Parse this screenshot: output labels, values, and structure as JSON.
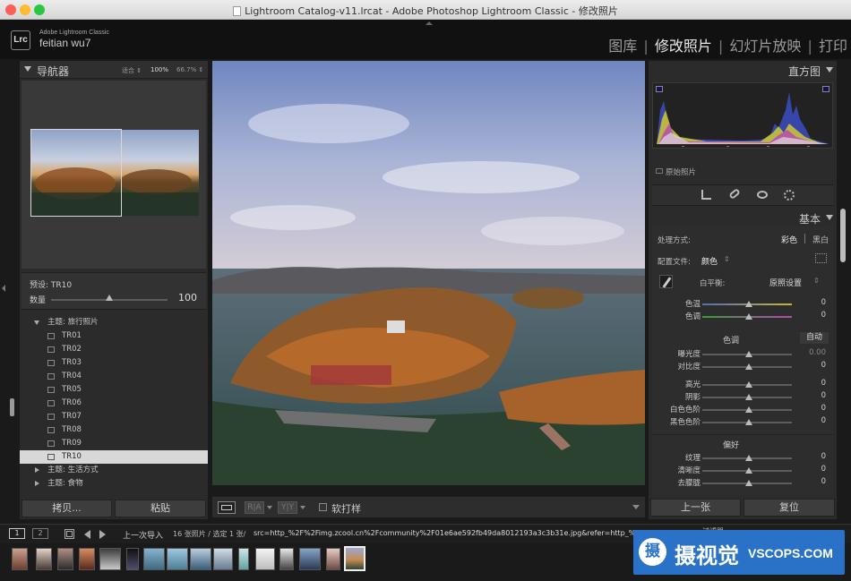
{
  "window": {
    "title": "Lightroom Catalog-v11.lrcat - Adobe Photoshop Lightroom Classic - 修改照片"
  },
  "identity": {
    "logo": "Lrc",
    "app_name": "Adobe Lightroom Classic",
    "user": "feitian wu7"
  },
  "modules": [
    {
      "label": "图库",
      "active": false
    },
    {
      "label": "修改照片",
      "active": true
    },
    {
      "label": "幻灯片放映",
      "active": false
    },
    {
      "label": "打印",
      "active": false
    }
  ],
  "navigator": {
    "title": "导航器",
    "zoom_fit": "适合 ⇕",
    "zoom_100": "100%",
    "zoom_other": "66.7% ⇕"
  },
  "preset_amount": {
    "preset_label": "预设: TR10",
    "amount_label": "数量",
    "amount_value": "100",
    "amount_fraction": 0.55
  },
  "presets": {
    "group_travel": "主题: 旅行照片",
    "items": [
      "TR01",
      "TR02",
      "TR03",
      "TR04",
      "TR05",
      "TR06",
      "TR07",
      "TR08",
      "TR09",
      "TR10"
    ],
    "selected": "TR10",
    "group_life": "主题: 生活方式",
    "group_food": "主题: 食物"
  },
  "left_buttons": {
    "copy": "拷贝...",
    "paste": "粘贴"
  },
  "toolbar": {
    "soft_proof": "软打样"
  },
  "histogram": {
    "title": "直方图",
    "original_photo": "原始照片"
  },
  "basic": {
    "title": "基本",
    "treatment_label": "处理方式:",
    "color": "彩色",
    "bw": "黑白",
    "profile_label": "配置文件:",
    "profile_value": "颜色",
    "wb_label": "白平衡:",
    "wb_value": "原照设置",
    "temp": {
      "label": "色温",
      "value": "0"
    },
    "tint": {
      "label": "色调",
      "value": "0"
    },
    "tone_title": "色调",
    "auto": "自动",
    "exposure": {
      "label": "曝光度",
      "value": "0.00"
    },
    "contrast": {
      "label": "对比度",
      "value": "0"
    },
    "highlights": {
      "label": "高光",
      "value": "0"
    },
    "shadows": {
      "label": "阴影",
      "value": "0"
    },
    "whites": {
      "label": "白色色阶",
      "value": "0"
    },
    "blacks": {
      "label": "黑色色阶",
      "value": "0"
    },
    "presence_title": "偏好",
    "texture": {
      "label": "纹理",
      "value": "0"
    },
    "clarity": {
      "label": "清晰度",
      "value": "0"
    },
    "dehaze": {
      "label": "去朦胧",
      "value": "0"
    }
  },
  "right_buttons": {
    "previous": "上一张",
    "reset": "复位"
  },
  "filmstrip": {
    "page1": "1",
    "page2": "2",
    "source": "上一次导入",
    "count": "16 张照片 / 选定 1 张/",
    "filename": "src=http_%2F%2Fimg.zcool.cn%2Fcommunity%2F01e6ae592fb49da8012193a3c3b31e.jpg&refer=http_%2F%",
    "filter_label": "过滤器"
  },
  "watermark": {
    "logo_char": "摄",
    "text": "摄视觉",
    "sub": "VSCOPS.COM"
  }
}
